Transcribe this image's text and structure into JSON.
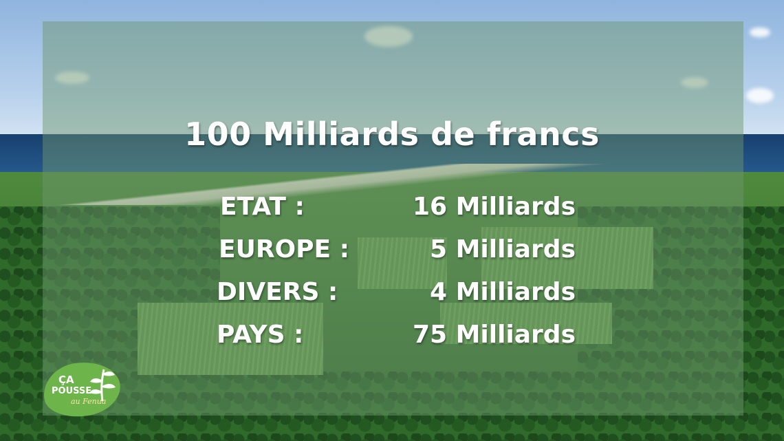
{
  "title": "100 Milliards de francs",
  "rows": [
    {
      "label": "ETAT :",
      "value": "16 Milliards"
    },
    {
      "label": "EUROPE :",
      "value": "5 Milliards"
    },
    {
      "label": "DIVERS :",
      "value": "4 Milliards"
    },
    {
      "label": "PAYS  :",
      "value": "75 Milliards"
    }
  ],
  "logo": {
    "line1": "ÇA",
    "line2": "POUSSE",
    "line3": "au Fenua",
    "icon": "leaf-icon",
    "color": "#6db54b"
  },
  "colors": {
    "panel": "#6e966e",
    "text": "#ffffff"
  }
}
